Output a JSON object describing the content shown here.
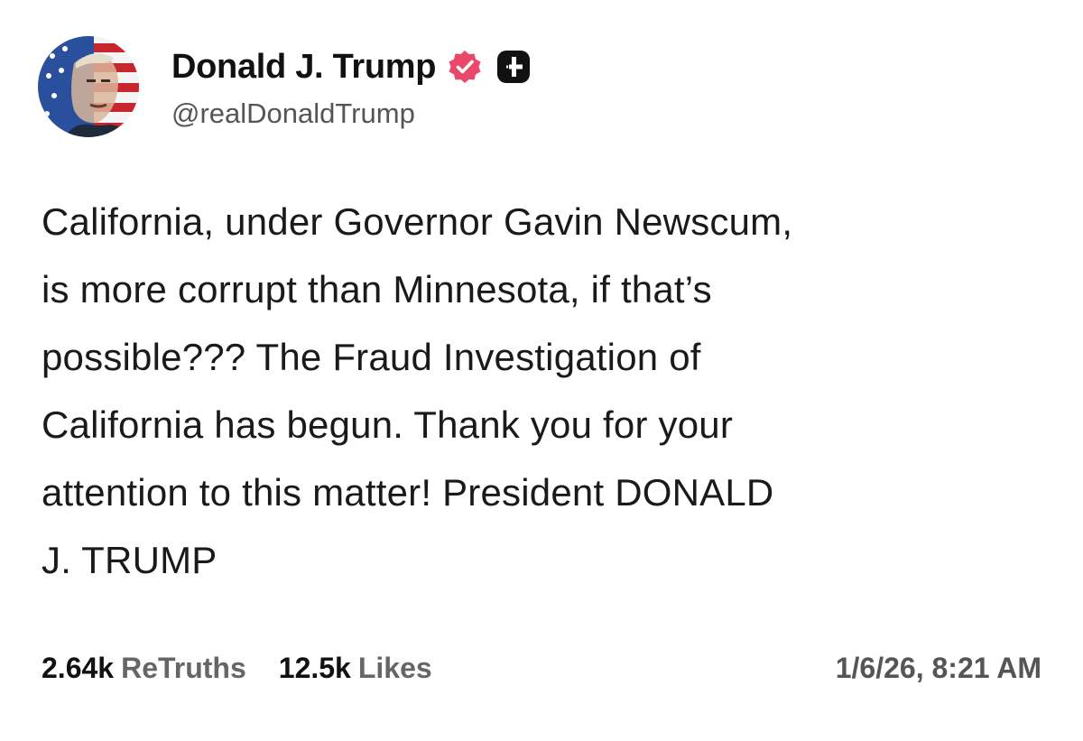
{
  "author": {
    "display_name": "Donald J. Trump",
    "handle": "@realDonaldTrump",
    "avatar_icon": "profile-portrait-flag",
    "verified_icon": "verified-badge-icon",
    "verified_color": "#e8496a",
    "plus_icon": "plus-badge-icon"
  },
  "post": {
    "text": "California, under Governor Gavin Newscum,\nis more corrupt than Minnesota, if that’s\npossible??? The Fraud Investigation of\nCalifornia has begun. Thank you for your\nattention to this matter! President DONALD\nJ. TRUMP"
  },
  "stats": {
    "retruths_count": "2.64k",
    "retruths_label": "ReTruths",
    "likes_count": "12.5k",
    "likes_label": "Likes"
  },
  "timestamp": "1/6/26, 8:21 AM"
}
